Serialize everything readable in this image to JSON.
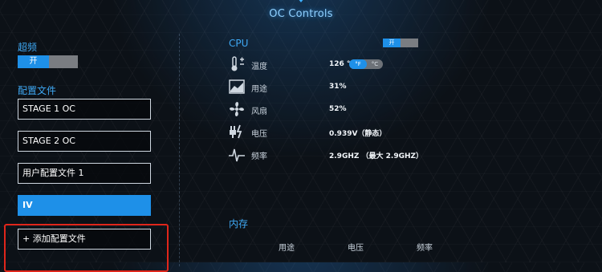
{
  "header": {
    "title": "OC Controls"
  },
  "sidebar": {
    "overclock_label": "超频",
    "overclock_toggle": "开",
    "profiles_label": "配置文件",
    "profiles": [
      {
        "label": "STAGE 1 OC",
        "active": false
      },
      {
        "label": "STAGE 2 OC",
        "active": false
      },
      {
        "label": "用户配置文件 1",
        "active": false
      },
      {
        "label": "IV",
        "active": true
      }
    ],
    "add_profile": "+ 添加配置文件"
  },
  "cpu": {
    "title": "CPU",
    "toggle": "开",
    "unit_f": "°F",
    "unit_c": "°C",
    "metrics": [
      {
        "icon": "thermometer-icon",
        "label": "温度",
        "value": "126 °F"
      },
      {
        "icon": "usage-graph-icon",
        "label": "用途",
        "value": "31%"
      },
      {
        "icon": "fan-icon",
        "label": "风扇",
        "value": "52%"
      },
      {
        "icon": "voltage-plug-icon",
        "label": "电压",
        "value": "0.939V（静态）"
      },
      {
        "icon": "frequency-pulse-icon",
        "label": "频率",
        "value": "2.9GHZ （最大 2.9GHZ）"
      }
    ]
  },
  "memory": {
    "title": "内存",
    "columns": [
      "用途",
      "电压",
      "频率"
    ]
  },
  "colors": {
    "accent": "#1e90e8",
    "highlight": "#e0261b",
    "section": "#3fa9f5"
  }
}
